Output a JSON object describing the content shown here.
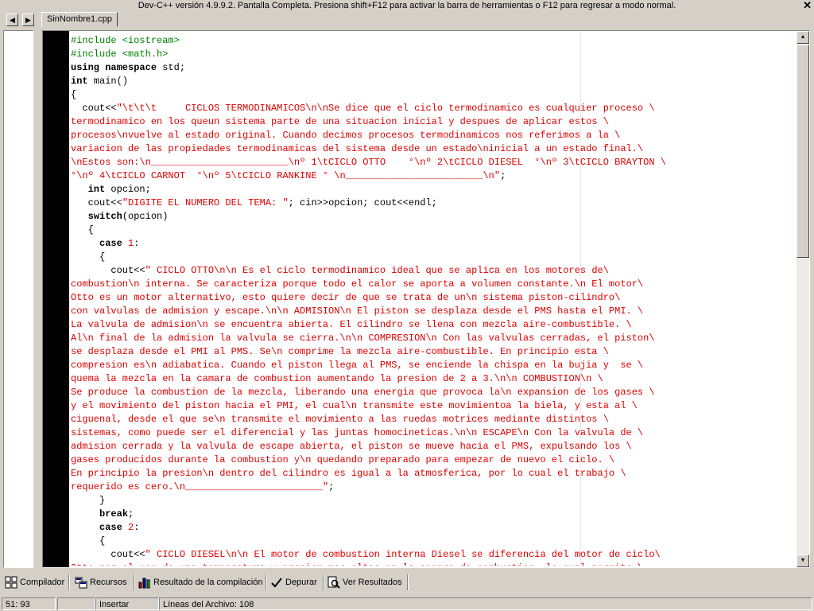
{
  "window": {
    "title": "Dev-C++ versión 4.9.9.2. Pantalla Completa. Presiona shift+F12 para activar la barra de herramientas o F12 para regresar a modo normal.",
    "close_glyph": "✕"
  },
  "nav": {
    "prev_glyph": "◀",
    "next_glyph": "▶"
  },
  "tab": {
    "filename": "SinNombre1.cpp"
  },
  "editor": {
    "lines": [
      [
        {
          "t": "pp",
          "v": "#include <iostream>"
        }
      ],
      [
        {
          "t": "pp",
          "v": "#include <math.h>"
        }
      ],
      [
        {
          "t": "kw",
          "v": "using namespace"
        },
        {
          "t": "n",
          "v": " std;"
        }
      ],
      [
        {
          "t": "kw",
          "v": "int"
        },
        {
          "t": "n",
          "v": " main()"
        }
      ],
      [
        {
          "t": "n",
          "v": "{"
        }
      ],
      [
        {
          "t": "n",
          "v": "  cout<<"
        },
        {
          "t": "str",
          "v": "\"\\t\\t\\t     CICLOS TERMODINAMICOS\\n\\nSe dice que el ciclo termodinamico es cualquier proceso \\"
        }
      ],
      [
        {
          "t": "str",
          "v": "termodinamico en los queun sistema parte de una situacion inicial y despues de aplicar estos \\"
        }
      ],
      [
        {
          "t": "str",
          "v": "procesos\\nvuelve al estado original. Cuando decimos procesos termodinamicos nos referimos a la \\"
        }
      ],
      [
        {
          "t": "str",
          "v": "variacion de las propiedades termodinamicas del sistema desde un estado\\ninicial a un estado final.\\"
        }
      ],
      [
        {
          "t": "str",
          "v": "\\nEstos son:\\n________________________\\nº 1\\tCICLO OTTO    °\\nº 2\\tCICLO DIESEL  °\\nº 3\\tCICLO BRAYTON \\"
        }
      ],
      [
        {
          "t": "str",
          "v": "°\\nº 4\\tCICLO CARNOT  °\\nº 5\\tCICLO RANKINE ° \\n________________________\\n\""
        },
        {
          "t": "n",
          "v": ";"
        }
      ],
      [
        {
          "t": "n",
          "v": "   "
        },
        {
          "t": "kw",
          "v": "int"
        },
        {
          "t": "n",
          "v": " opcion;"
        }
      ],
      [
        {
          "t": "n",
          "v": "   cout<<"
        },
        {
          "t": "str",
          "v": "\"DIGITE EL NUMERO DEL TEMA: \""
        },
        {
          "t": "n",
          "v": "; cin>>opcion; cout<<endl;"
        }
      ],
      [
        {
          "t": "n",
          "v": "   "
        },
        {
          "t": "kw",
          "v": "switch"
        },
        {
          "t": "n",
          "v": "(opcion)"
        }
      ],
      [
        {
          "t": "n",
          "v": "   {"
        }
      ],
      [
        {
          "t": "n",
          "v": "     "
        },
        {
          "t": "kw",
          "v": "case"
        },
        {
          "t": "n",
          "v": " "
        },
        {
          "t": "num",
          "v": "1"
        },
        {
          "t": "n",
          "v": ":"
        }
      ],
      [
        {
          "t": "n",
          "v": "     {"
        }
      ],
      [
        {
          "t": "n",
          "v": "       cout<<"
        },
        {
          "t": "str",
          "v": "\" CICLO OTTO\\n\\n Es el ciclo termodinamico ideal que se aplica en los motores de\\"
        }
      ],
      [
        {
          "t": "str",
          "v": "combustion\\n interna. Se caracteriza porque todo el calor se aporta a volumen constante.\\n El motor\\"
        }
      ],
      [
        {
          "t": "str",
          "v": "Otto es un motor alternativo, esto quiere decir de que se trata de un\\n sistema piston-cilindro\\"
        }
      ],
      [
        {
          "t": "str",
          "v": "con valvulas de admision y escape.\\n\\n ADMISION\\n El piston se desplaza desde el PMS hasta el PMI. \\"
        }
      ],
      [
        {
          "t": "str",
          "v": "La valvula de admision\\n se encuentra abierta. El cilindro se llena con mezcla aire-combustible. \\"
        }
      ],
      [
        {
          "t": "str",
          "v": "Al\\n final de la admision la valvula se cierra.\\n\\n COMPRESION\\n Con las valvulas cerradas, el piston\\"
        }
      ],
      [
        {
          "t": "str",
          "v": "se desplaza desde el PMI al PMS. Se\\n comprime la mezcla aire-combustible. En principio esta \\"
        }
      ],
      [
        {
          "t": "str",
          "v": "compresion es\\n adiabatica. Cuando el piston llega al PMS, se enciende la chispa en la bujia y  se \\"
        }
      ],
      [
        {
          "t": "str",
          "v": "quema la mezcla en la camara de combustion aumentando la presion de 2 a 3.\\n\\n COMBUSTION\\n \\"
        }
      ],
      [
        {
          "t": "str",
          "v": "Se produce la combustion de la mezcla, liberando una energia que provoca la\\n expansion de los gases \\"
        }
      ],
      [
        {
          "t": "str",
          "v": "y el movimiento del piston hacia el PMI, el cual\\n transmite este movimientoa la biela, y esta al \\"
        }
      ],
      [
        {
          "t": "str",
          "v": "ciguenal, desde el que se\\n transmite el movimiento a las ruedas motrices mediante distintos \\"
        }
      ],
      [
        {
          "t": "str",
          "v": "sistemas, como puede ser el diferencial y las juntas homocineticas.\\n\\n ESCAPE\\n Con la valvula de \\"
        }
      ],
      [
        {
          "t": "str",
          "v": "admision cerrada y la valvula de escape abierta, el piston se mueve hacia el PMS, expulsando los \\"
        }
      ],
      [
        {
          "t": "str",
          "v": "gases producidos durante la combustion y\\n quedando preparado para empezar de nuevo el ciclo. \\"
        }
      ],
      [
        {
          "t": "str",
          "v": "En principio la presion\\n dentro del cilindro es igual a la atmosferica, por lo cual el trabajo \\"
        }
      ],
      [
        {
          "t": "str",
          "v": "requerido es cero.\\n________________________\""
        },
        {
          "t": "n",
          "v": ";"
        }
      ],
      [
        {
          "t": "n",
          "v": "     }"
        }
      ],
      [
        {
          "t": "n",
          "v": "     "
        },
        {
          "t": "kw",
          "v": "break"
        },
        {
          "t": "n",
          "v": ";"
        }
      ],
      [
        {
          "t": "n",
          "v": "     "
        },
        {
          "t": "kw",
          "v": "case"
        },
        {
          "t": "n",
          "v": " "
        },
        {
          "t": "num",
          "v": "2"
        },
        {
          "t": "n",
          "v": ":"
        }
      ],
      [
        {
          "t": "n",
          "v": "     {"
        }
      ],
      [
        {
          "t": "n",
          "v": "       cout<<"
        },
        {
          "t": "str",
          "v": "\" CICLO DIESEL\\n\\n El motor de combustion interna Diesel se diferencia del motor de ciclo\\"
        }
      ],
      [
        {
          "t": "str",
          "v": "Otto por el uso de una temperatura y presion mas altas en la camara de combustion, lo cual permite \\"
        }
      ]
    ]
  },
  "bottom_tabs": [
    {
      "label": "Compilador",
      "icon": "compiler-icon"
    },
    {
      "label": "Recursos",
      "icon": "resources-icon"
    },
    {
      "label": "Resultado de la compilación",
      "icon": "compile-log-icon"
    },
    {
      "label": "Depurar",
      "icon": "debug-icon"
    },
    {
      "label": "Ver Resultados",
      "icon": "find-results-icon"
    }
  ],
  "status": {
    "position": "51: 93",
    "blank": "",
    "mode": "Insertar",
    "lines": "Líneas del Archivo: 108"
  }
}
